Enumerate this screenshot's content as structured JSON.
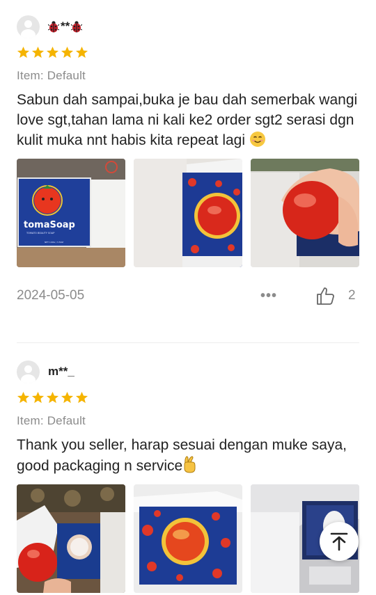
{
  "reviews": [
    {
      "username_masked": "**",
      "username_icon": "ladybug-icon",
      "rating": 5,
      "variant": "Item: Default",
      "text": "Sabun dah sampai,buka je bau dah semerbak wangi love sgt,tahan lama ni kali ke2 order sgt2 serasi dgn kulit muka nnt habis kita repeat lagi",
      "text_emoji": "smiling-face-icon",
      "photos": [
        {
          "brand": "tomaSoap",
          "small_text": "TOMATO BEAUTY SOAP",
          "tiny_text": "NET 100G / 3.5OZ"
        },
        {},
        {}
      ],
      "date": "2024-05-05",
      "more": "•••",
      "likes": "2"
    },
    {
      "username": "m**_",
      "rating": 5,
      "variant": "Item: Default",
      "text": "Thank you seller, harap sesuai dengan muke saya, good packaging n service",
      "text_emoji": "crossed-fingers-icon",
      "photos": [
        {},
        {},
        {}
      ]
    }
  ],
  "colors": {
    "star": "#f5b400",
    "muted": "#8b8b8b",
    "text": "#222222"
  },
  "scroll_to_top_icon": "arrow-up-to-top-icon"
}
